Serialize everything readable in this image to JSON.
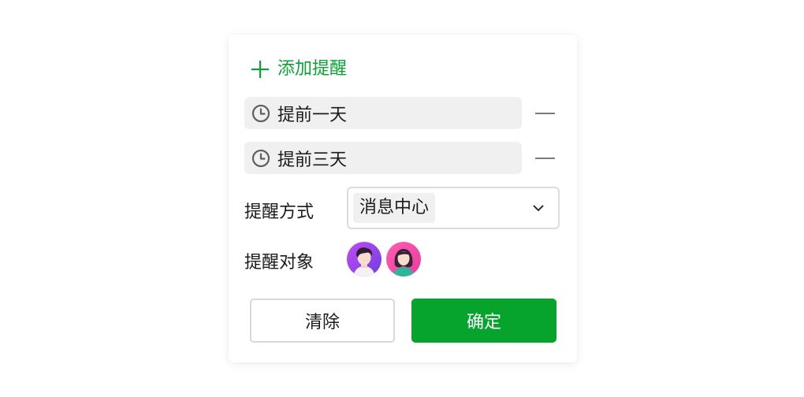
{
  "panel": {
    "add_label": "添加提醒",
    "reminders": [
      {
        "label": "提前一天"
      },
      {
        "label": "提前三天"
      }
    ],
    "method": {
      "label": "提醒方式",
      "selected": "消息中心"
    },
    "target": {
      "label": "提醒对象",
      "avatars": [
        "user-avatar-male",
        "user-avatar-female"
      ]
    },
    "buttons": {
      "clear": "清除",
      "confirm": "确定"
    }
  },
  "colors": {
    "accent": "#0aa334",
    "confirm_bg": "#06a42d",
    "chip_bg": "#f0f0f0",
    "border": "#dcdcdc",
    "text": "#1a1a1a",
    "icon": "#5f5f5f"
  }
}
